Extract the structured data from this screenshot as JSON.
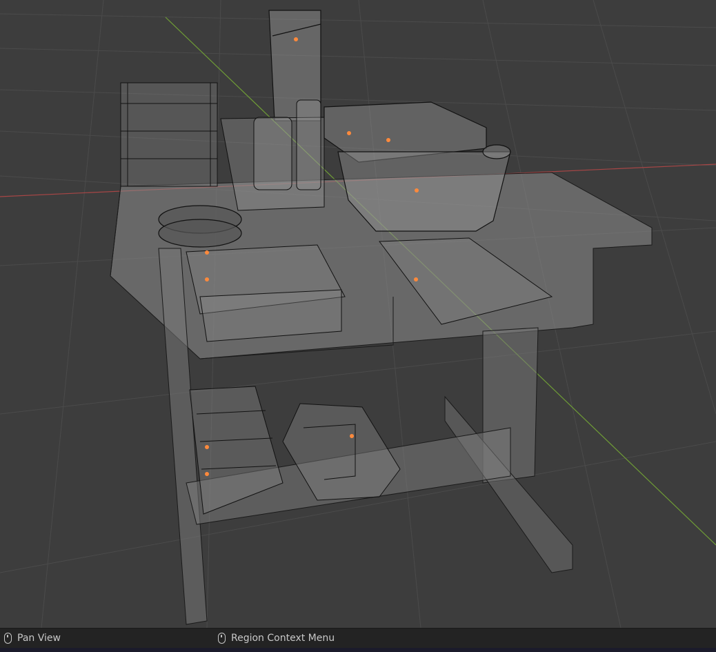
{
  "statusbar": {
    "hint1": {
      "icon": "mouse-left-icon",
      "label": "Pan View"
    },
    "hint2": {
      "icon": "mouse-right-icon",
      "label": "Region Context Menu"
    }
  },
  "colors": {
    "viewport_bg": "#3d3d3d",
    "grid": "#4a4a4a",
    "x_axis": "#b04a4a",
    "y_axis": "#7aa83a",
    "wire": "#111111",
    "surface": "#8a8a8a",
    "origin": "#ff8a3c",
    "status_bg": "#232323"
  }
}
